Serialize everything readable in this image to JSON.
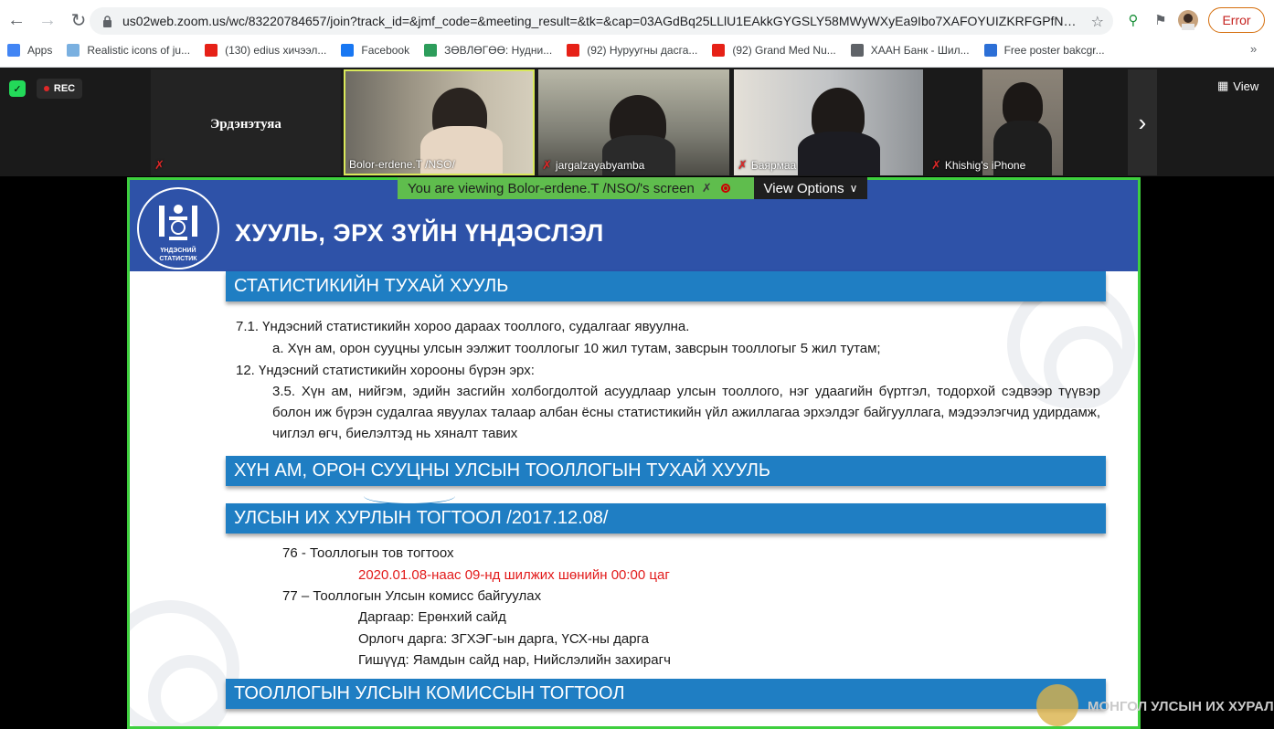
{
  "browser": {
    "url": "us02web.zoom.us/wc/83220784657/join?track_id=&jmf_code=&meeting_result=&tk=&cap=03AGdBq25LLlU1EAkkGYGSLY58MWyWXyEa9Ibo7XAFOYUIZKRFGPfNwmE...",
    "error_label": "Error",
    "bookmarks": [
      {
        "label": "Apps",
        "color": "#4285f4"
      },
      {
        "label": "Realistic icons of ju...",
        "color": "#7ab0e0"
      },
      {
        "label": "(130) edius хичээл...",
        "color": "#e62117"
      },
      {
        "label": "Facebook",
        "color": "#1877f2"
      },
      {
        "label": "ЗӨВЛӨГӨӨ: Нудни...",
        "color": "#2d9d5b"
      },
      {
        "label": "(92) Нуруугны дасга...",
        "color": "#e62117"
      },
      {
        "label": "(92) Grand Med Nu...",
        "color": "#e62117"
      },
      {
        "label": "ХААН Банк - Шил...",
        "color": "#5f6368"
      },
      {
        "label": "Free poster bakcgr...",
        "color": "#2c6fd6"
      }
    ]
  },
  "zoom": {
    "rec_label": "REC",
    "view_label": "View",
    "participants": [
      {
        "name": "Эрдэнэтуяа",
        "video": false,
        "muted": true
      },
      {
        "name": "Bolor-erdene.T /NSO/",
        "video": true,
        "muted": false
      },
      {
        "name": "jargalzayabyamba",
        "video": true,
        "muted": true
      },
      {
        "name": "Баярмаа",
        "video": true,
        "muted": true
      },
      {
        "name": "Khishig's iPhone",
        "video": true,
        "muted": true
      }
    ],
    "share_banner": "You are viewing Bolor-erdene.T /NSO/'s screen",
    "view_options": "View Options"
  },
  "slide": {
    "logo_line1": "ҮНДЭСНИЙ",
    "logo_line2": "СТАТИСТИК",
    "title": "ХУУЛЬ, ЭРХ ЗҮЙН ҮНДЭСЛЭЛ",
    "section1": "СТАТИСТИКИЙН ТУХАЙ ХУУЛЬ",
    "s1_l1": "7.1. Үндэсний статистикийн хороо дараах тооллого, судалгааг явуулна.",
    "s1_l2": "а. Хүн ам, орон сууцны улсын ээлжит тооллогыг 10 жил тутам, завсрын тооллогыг 5 жил тутам;",
    "s1_l3": "12. Үндэсний статистикийн хорооны бүрэн эрх:",
    "s1_l4": "3.5. Хүн ам, нийгэм, эдийн засгийн холбогдолтой асуудлаар улсын тооллого, нэг удаагийн бүртгэл, тодорхой сэдвээр түүвэр болон иж бүрэн судалгаа явуулах талаар албан ёсны статистикийн үйл ажиллагаа эрхэлдэг байгууллага, мэдээлэгчид удирдамж, чиглэл өгч, биелэлтэд нь хяналт тавих",
    "section2": "ХҮН АМ, ОРОН СУУЦНЫ УЛСЫН ТООЛЛОГЫН ТУХАЙ ХУУЛЬ",
    "section3": "УЛСЫН ИХ ХУРЛЫН ТОГТООЛ /2017.12.08/",
    "s3_l1": "76 - Тооллогын тов тогтоох",
    "s3_l2": "2020.01.08-наас 09-нд шилжих шөнийн 00:00 цаг",
    "s3_l3": "77 – Тооллогын Улсын комисс байгуулах",
    "s3_l4": "Даргаар: Ерөнхий сайд",
    "s3_l5": "Орлогч дарга: ЗГХЭГ-ын дарга, ҮСХ-ны дарга",
    "s3_l6": "Гишүүд: Яамдын сайд нар, Нийслэлийн захирагч",
    "section4": "ТООЛЛОГЫН УЛСЫН КОМИССЫН ТОГТООЛ",
    "watermark": "МОНГОЛ УЛСЫН ИХ ХУРАЛ"
  }
}
